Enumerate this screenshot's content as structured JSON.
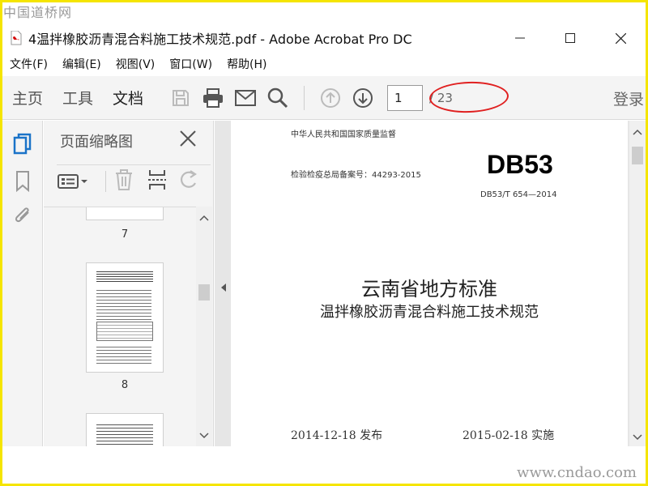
{
  "watermark": {
    "top": "中国道桥网",
    "bottom": "www.cndao.com"
  },
  "window": {
    "title": "4温拌橡胶沥青混合料施工技术规范.pdf - Adobe Acrobat Pro DC"
  },
  "menu": [
    "文件(F)",
    "编辑(E)",
    "视图(V)",
    "窗口(W)",
    "帮助(H)"
  ],
  "toolbar": {
    "tabs": [
      "主页",
      "工具",
      "文档"
    ],
    "active_tab": "文档",
    "current_page": "1",
    "page_total": "/ 23",
    "login_label": "登录",
    "icons": [
      "save-icon",
      "print-icon",
      "mail-icon",
      "search-icon",
      "prev-page-icon",
      "next-page-icon"
    ]
  },
  "sidebar": {
    "panel_title": "页面缩略图",
    "thumbnails": [
      {
        "label": "7"
      },
      {
        "label": "8"
      }
    ]
  },
  "document": {
    "authority": "中华人民共和国国家质量监督",
    "record_no": "检验检疫总局备案号：44293-2015",
    "db_code": "DB53",
    "standard_no": "DB53/T 654—2014",
    "title_main": "云南省地方标准",
    "title_sub": "温拌橡胶沥青混合料施工技术规范",
    "release": "2014-12-18 发布",
    "effective": "2015-02-18 实施"
  },
  "colors": {
    "frame": "#f5e500",
    "highlight_oval": "#e02020",
    "pdf_red": "#d40000"
  }
}
